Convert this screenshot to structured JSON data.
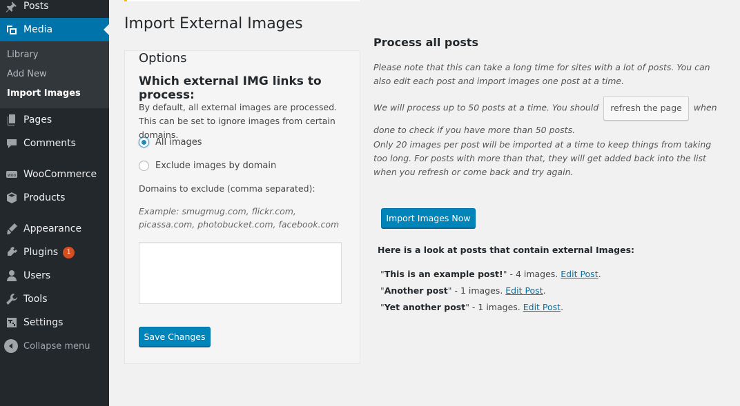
{
  "sidebar": {
    "posts": "Posts",
    "media": "Media",
    "submenu": {
      "library": "Library",
      "add_new": "Add New",
      "import_images": "Import Images"
    },
    "pages": "Pages",
    "comments": "Comments",
    "woocommerce": "WooCommerce",
    "products": "Products",
    "appearance": "Appearance",
    "plugins": "Plugins",
    "plugins_badge": "1",
    "users": "Users",
    "tools": "Tools",
    "settings": "Settings",
    "collapse": "Collapse menu"
  },
  "main": {
    "title": "Import External Images",
    "options": {
      "heading": "Options",
      "subheading": "Which external IMG links to process:",
      "description": "By default, all external images are processed. This can be set to ignore images from certain domains.",
      "radio_all": "All images",
      "radio_exclude": "Exclude images by domain",
      "domains_label": "Domains to exclude (comma separated):",
      "example": "Example: smugmug.com, flickr.com, picassa.com, photobucket.com, facebook.com",
      "textarea_value": "",
      "save_button": "Save Changes"
    },
    "process": {
      "title": "Process all posts",
      "note1": "Please note that this can take a long time for sites with a lot of posts. You can also edit each post and import images one post at a time.",
      "note2_before": "We will process up to 50 posts at a time. You should",
      "refresh_button": "refresh the page",
      "note2_after": "when done to check if you have more than 50 posts.",
      "note3": "Only 20 images per post will be imported at a time to keep things from taking too long. For posts with more than that, they will get added back into the list when you refresh or come back and try again.",
      "import_button": "Import Images Now",
      "look_title": "Here is a look at posts that contain external Images:",
      "posts": [
        {
          "title": "This is an example post!",
          "count": " - 4 images. ",
          "link": "Edit Post"
        },
        {
          "title": "Another post",
          "count": " - 1 images. ",
          "link": "Edit Post"
        },
        {
          "title": "Yet another post",
          "count": " - 1 images. ",
          "link": "Edit Post"
        }
      ]
    }
  },
  "colors": {
    "sidebar_bg": "#23282d",
    "submenu_bg": "#32373c",
    "active": "#0073aa",
    "primary_button": "#0085ba",
    "badge": "#d54e21",
    "link": "#0073aa"
  }
}
